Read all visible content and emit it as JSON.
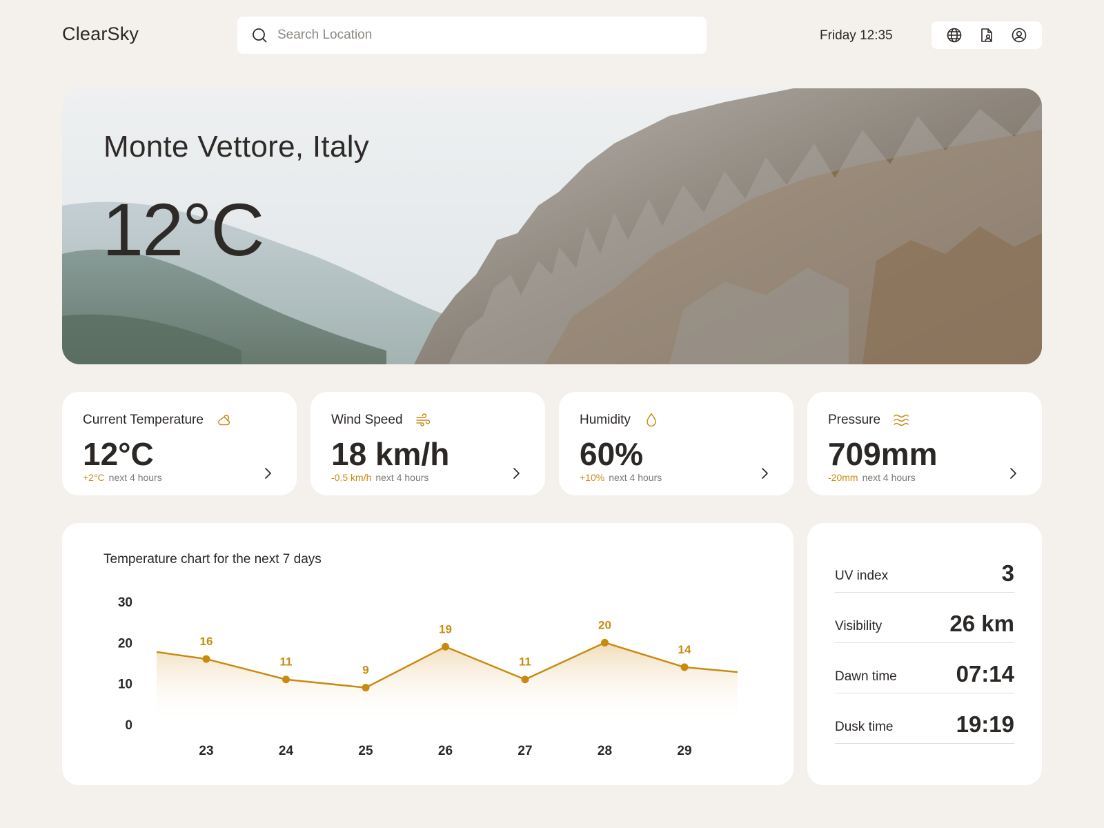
{
  "app": {
    "title": "ClearSky"
  },
  "search": {
    "placeholder": "Search Location"
  },
  "header": {
    "datetime": "Friday 12:35"
  },
  "hero": {
    "location": "Monte Vettore, Italy",
    "temperature": "12°C"
  },
  "cards": [
    {
      "label": "Current Temperature",
      "value": "12°C",
      "delta": "+2°C",
      "period": "next 4 hours",
      "icon": "cloud-sun-icon"
    },
    {
      "label": "Wind Speed",
      "value": "18 km/h",
      "delta": "-0.5 km/h",
      "period": "next 4 hours",
      "icon": "wind-icon"
    },
    {
      "label": "Humidity",
      "value": "60%",
      "delta": "+10%",
      "period": "next 4 hours",
      "icon": "droplet-icon"
    },
    {
      "label": "Pressure",
      "value": "709mm",
      "delta": "-20mm",
      "period": "next 4 hours",
      "icon": "waves-icon"
    }
  ],
  "chart_title": "Temperature chart for the next 7 days",
  "chart_data": {
    "type": "line",
    "title": "Temperature chart for the next 7 days",
    "x": [
      "23",
      "24",
      "25",
      "26",
      "27",
      "28",
      "29"
    ],
    "values": [
      16,
      11,
      9,
      19,
      11,
      20,
      14
    ],
    "yticks": [
      0,
      10,
      20,
      30
    ],
    "ylim": [
      0,
      30
    ],
    "color": "#c98a10",
    "fill": "area-gradient",
    "grid": false,
    "legend": "none"
  },
  "side_stats": [
    {
      "label": "UV index",
      "value": "3"
    },
    {
      "label": "Visibility",
      "value": "26 km"
    },
    {
      "label": "Dawn time",
      "value": "07:14"
    },
    {
      "label": "Dusk time",
      "value": "19:19"
    }
  ],
  "colors": {
    "accent": "#c98a10",
    "background": "#f4f1ec",
    "card": "#ffffff",
    "text": "#2b2725"
  }
}
